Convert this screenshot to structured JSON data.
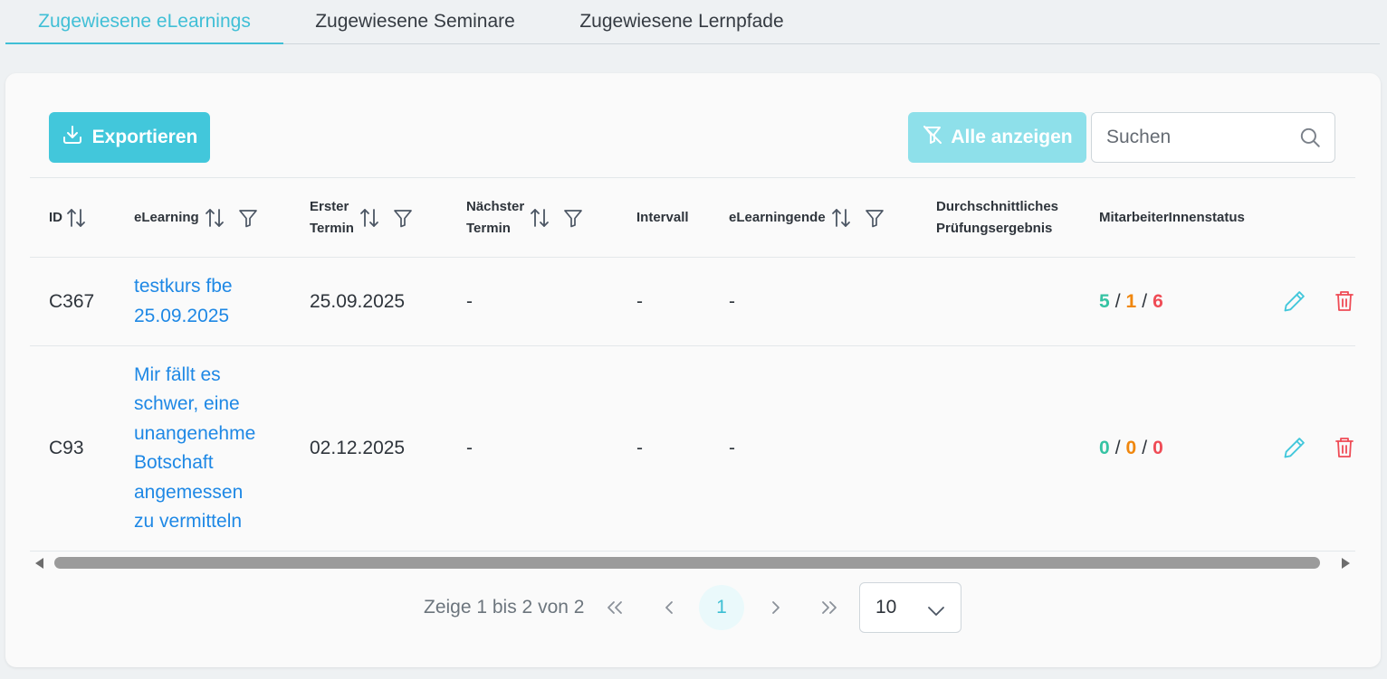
{
  "tabs": [
    {
      "label": "Zugewiesene eLearnings",
      "active": true
    },
    {
      "label": "Zugewiesene Seminare",
      "active": false
    },
    {
      "label": "Zugewiesene Lernpfade",
      "active": false
    }
  ],
  "toolbar": {
    "export_label": "Exportieren",
    "show_all_label": "Alle anzeigen",
    "search_placeholder": "Suchen"
  },
  "table": {
    "columns": [
      {
        "label": "ID",
        "sortable": true,
        "filterable": false
      },
      {
        "label": "eLearning",
        "sortable": true,
        "filterable": true
      },
      {
        "label": "Erster\nTermin",
        "sortable": true,
        "filterable": true
      },
      {
        "label": "Nächster\nTermin",
        "sortable": true,
        "filterable": true
      },
      {
        "label": "Intervall",
        "sortable": false,
        "filterable": false
      },
      {
        "label": "eLearningende",
        "sortable": true,
        "filterable": true
      },
      {
        "label": "Durchschnittliches\nPrüfungsergebnis",
        "sortable": false,
        "filterable": false
      },
      {
        "label": "MitarbeiterInnenstatus",
        "sortable": false,
        "filterable": false
      }
    ],
    "rows": [
      {
        "id": "C367",
        "elearning": "testkurs fbe\n25.09.2025",
        "first_date": "25.09.2025",
        "next_date": "-",
        "interval": "-",
        "end": "-",
        "avg_result": "",
        "status": {
          "green": "5",
          "orange": "1",
          "red": "6",
          "sep": "/"
        }
      },
      {
        "id": "C93",
        "elearning": "Mir fällt es\nschwer, eine\nunangenehme\nBotschaft\nangemessen\nzu vermitteln",
        "first_date": "02.12.2025",
        "next_date": "-",
        "interval": "-",
        "end": "-",
        "avg_result": "",
        "status": {
          "green": "0",
          "orange": "0",
          "red": "0",
          "sep": "/"
        }
      }
    ]
  },
  "pagination": {
    "info": "Zeige 1 bis 2 von 2",
    "current_page": "1",
    "page_size": "10"
  },
  "colors": {
    "accent": "#42c7db",
    "link": "#1e88e5",
    "status_green": "#35c3a3",
    "status_orange": "#f0870e",
    "status_red": "#ef4b55"
  },
  "icons": {
    "export": "download-icon",
    "show_all": "filter-off-icon",
    "search": "search-icon",
    "sort": "sort-icon",
    "filter": "filter-icon",
    "edit": "pencil-icon",
    "delete": "trash-icon"
  }
}
